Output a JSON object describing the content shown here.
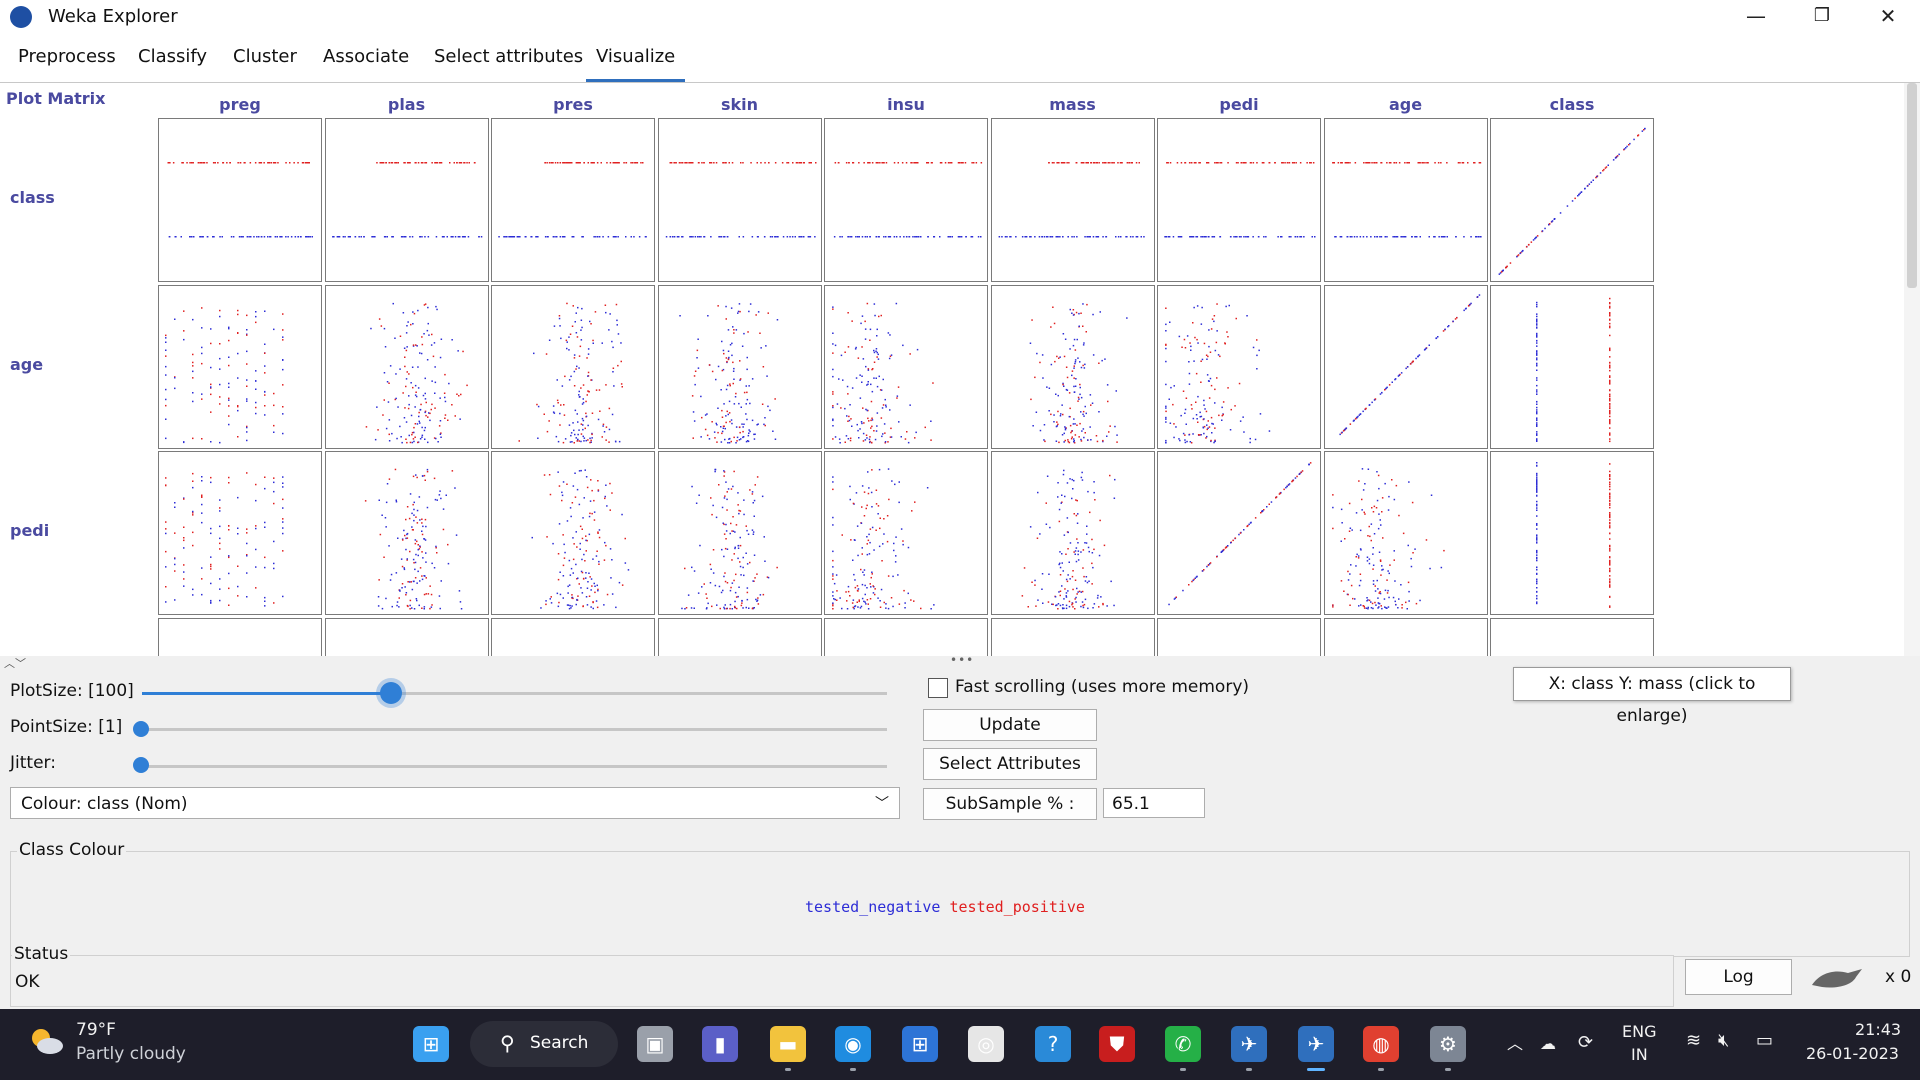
{
  "window": {
    "title": "Weka Explorer",
    "minimize_glyph": "—",
    "maximize_glyph": "❐",
    "close_glyph": "✕"
  },
  "tabs": [
    {
      "label": "Preprocess"
    },
    {
      "label": "Classify"
    },
    {
      "label": "Cluster"
    },
    {
      "label": "Associate"
    },
    {
      "label": "Select attributes"
    },
    {
      "label": "Visualize",
      "active": true
    }
  ],
  "matrix": {
    "title": "Plot Matrix",
    "columns": [
      "preg",
      "plas",
      "pres",
      "skin",
      "insu",
      "mass",
      "pedi",
      "age",
      "class"
    ],
    "rows": [
      "class",
      "age",
      "pedi",
      ""
    ]
  },
  "controls": {
    "plot_size_label": "PlotSize: [100]",
    "plot_size_value": 0.34,
    "point_size_label": "PointSize: [1]",
    "point_size_value": 0.0,
    "jitter_label": "Jitter:",
    "jitter_value": 0.0,
    "colour_select": "Colour: class  (Nom)",
    "fast_scrolling_label": "Fast scrolling (uses more memory)",
    "fast_scrolling_checked": false,
    "update_button": "Update",
    "select_attributes_button": "Select Attributes",
    "subsample_button": "SubSample % :",
    "subsample_value": "65.1",
    "tooltip": "X: class Y: mass (click to enlarge)"
  },
  "class_colour": {
    "title": "Class Colour",
    "items": [
      {
        "label": "tested_negative",
        "color": "#2d2dd6"
      },
      {
        "label": "tested_positive",
        "color": "#e02020"
      }
    ]
  },
  "status": {
    "title": "Status",
    "text": "OK",
    "log_button": "Log",
    "x_count": "x 0"
  },
  "taskbar": {
    "weather_temp": "79°F",
    "weather_desc": "Partly cloudy",
    "search_label": "Search",
    "lang_line1": "ENG",
    "lang_line2": "IN",
    "time": "21:43",
    "date": "26-01-2023",
    "apps": [
      "windows-start-icon",
      "search-icon",
      "task-view-icon",
      "teams-chat-icon",
      "file-explorer-icon",
      "edge-icon",
      "store-icon",
      "app-icon",
      "help-icon",
      "mcafee-icon",
      "whatsapp-icon",
      "weka-icon",
      "weka-active-icon",
      "chrome-icon",
      "settings-icon"
    ]
  }
}
